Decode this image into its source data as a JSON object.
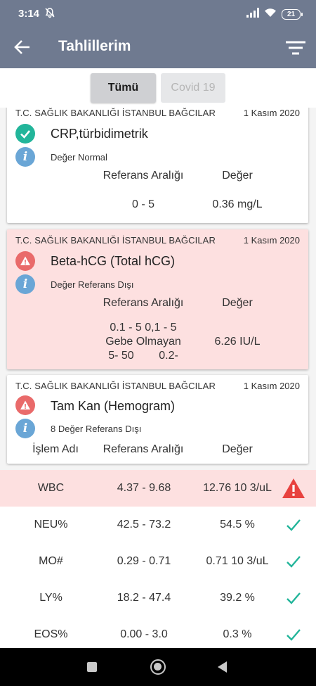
{
  "status_bar": {
    "time": "3:14",
    "battery": "21"
  },
  "app_bar": {
    "title": "Tahlillerim"
  },
  "tabs": [
    {
      "label": "Tümü",
      "active": true
    },
    {
      "label": "Covid 19",
      "active": false
    }
  ],
  "cards": [
    {
      "hospital": "T.C. SAĞLIK BAKANLIĞI İSTANBUL BAĞCILAR",
      "date": "1 Kasım 2020",
      "status": "normal",
      "test_name": "CRP,türbidimetrik",
      "summary": "Değer Normal",
      "col_ref": "Referans Aralığı",
      "col_value": "Değer",
      "ref_range": "0 - 5",
      "value": "0.36 mg/L"
    },
    {
      "hospital": "T.C. SAĞLIK BAKANLIĞI İSTANBUL BAĞCILAR",
      "date": "1 Kasım 2020",
      "status": "out_of_range",
      "test_name": "Beta-hCG (Total hCG)",
      "summary": "Değer Referans Dışı",
      "col_ref": "Referans Aralığı",
      "col_value": "Değer",
      "ref_range_lines": [
        "0.1 - 5 0,1 - 5",
        "Gebe Olmayan",
        "5- 50        0.2-"
      ],
      "value": "6.26 IU/L"
    },
    {
      "hospital": "T.C. SAĞLIK BAKANLIĞI İSTANBUL BAĞCILAR",
      "date": "1 Kasım 2020",
      "status": "out_of_range",
      "test_name": "Tam Kan (Hemogram)",
      "summary": "8 Değer Referans Dışı",
      "col_name": "İşlem Adı",
      "col_ref": "Referans Aralığı",
      "col_value": "Değer"
    }
  ],
  "hemogram_rows": [
    {
      "name": "WBC",
      "ref": "4.37 - 9.68",
      "value": "12.76 10 3/uL",
      "status": "out_of_range"
    },
    {
      "name": "NEU%",
      "ref": "42.5 - 73.2",
      "value": "54.5 %",
      "status": "normal"
    },
    {
      "name": "MO#",
      "ref": "0.29 - 0.71",
      "value": "0.71 10 3/uL",
      "status": "normal"
    },
    {
      "name": "LY%",
      "ref": "18.2 - 47.4",
      "value": "39.2 %",
      "status": "normal"
    },
    {
      "name": "EOS%",
      "ref": "0.00 - 3.0",
      "value": "0.3 %",
      "status": "normal"
    }
  ],
  "colors": {
    "app_bar": "#6f7a90",
    "normal": "#22b59a",
    "warning": "#e96a6a",
    "danger_bg": "#fde0e0",
    "info": "#6aa6d6"
  }
}
